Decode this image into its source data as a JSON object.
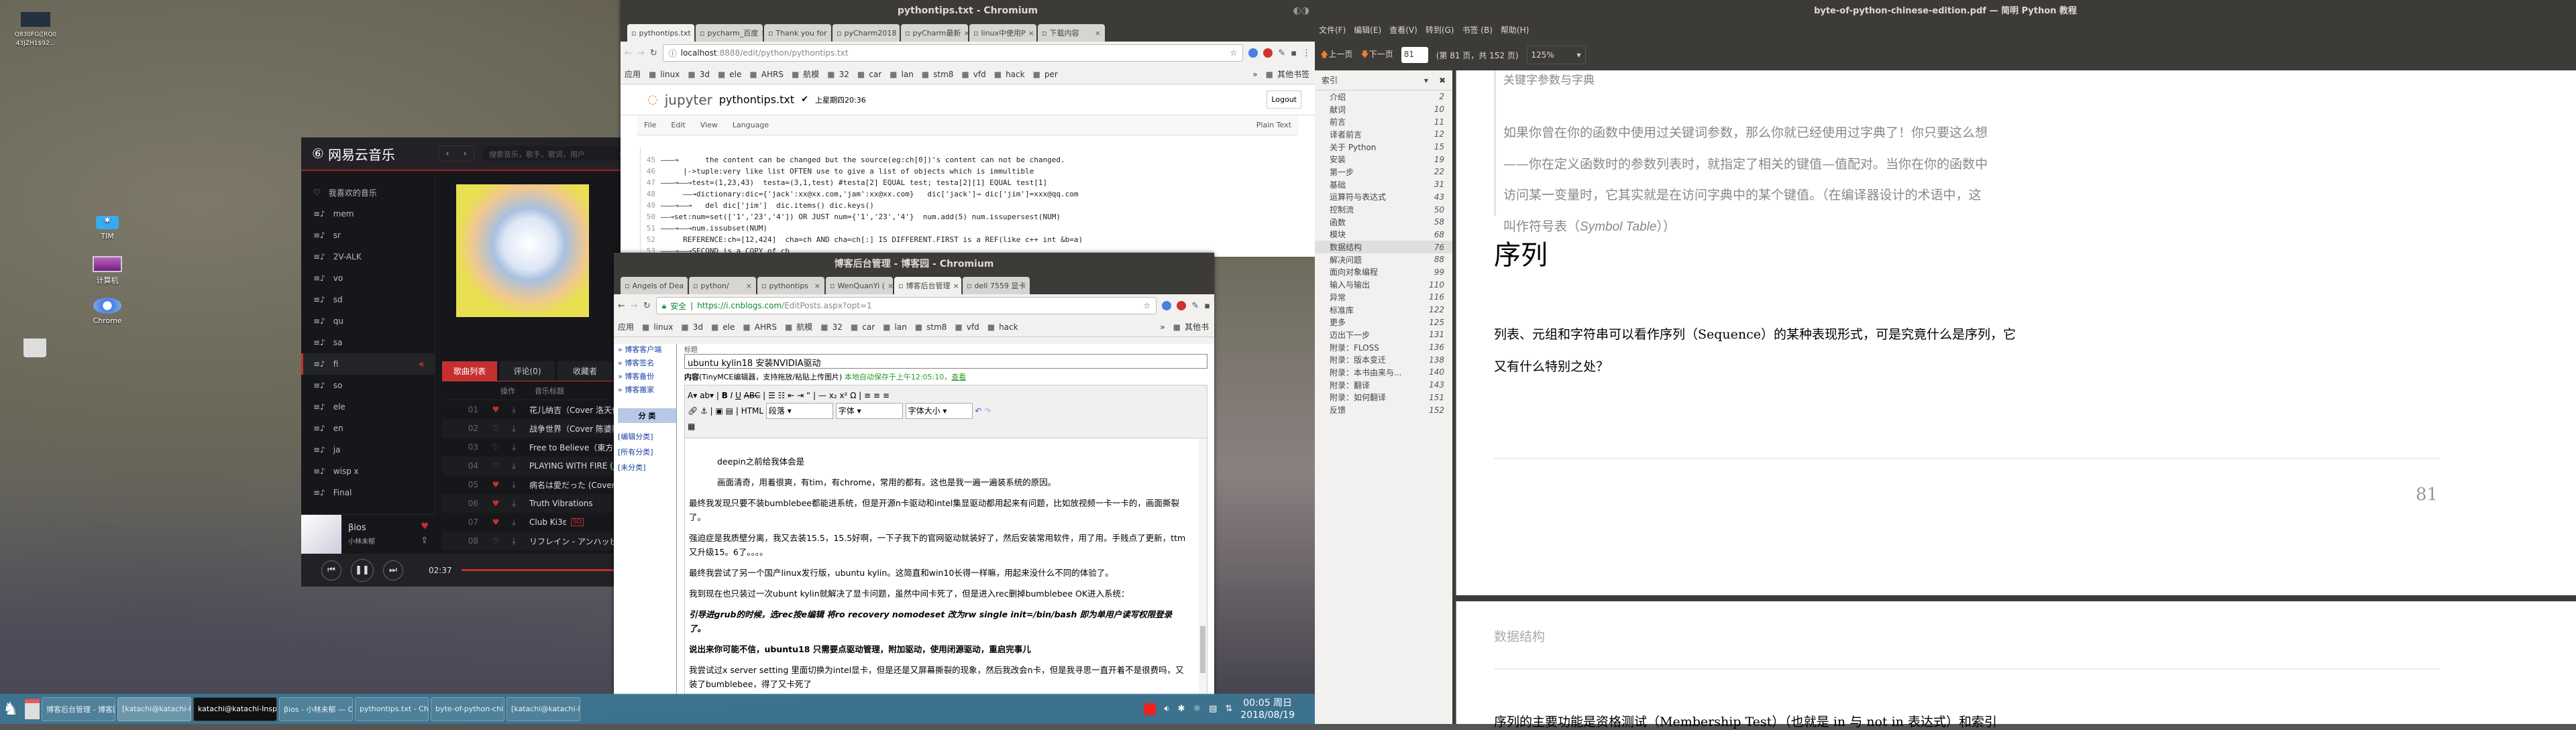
{
  "desktop": {
    "icons": [
      {
        "label": "Q830FG([RQ0 43JZH1$92..."
      },
      {
        "label": "TIM"
      },
      {
        "label": "计算机"
      },
      {
        "label": "Chrome"
      }
    ]
  },
  "music": {
    "app_name": "网易云音乐",
    "search_placeholder": "搜索音乐，歌手，歌词，用户",
    "playlists": [
      {
        "label": "我喜欢的音乐",
        "icon": "heart-icon"
      },
      {
        "label": "mem"
      },
      {
        "label": "sr"
      },
      {
        "label": "2V-ALK"
      },
      {
        "label": "vo"
      },
      {
        "label": "sd"
      },
      {
        "label": "qu"
      },
      {
        "label": "sa"
      },
      {
        "label": "fi",
        "selected": true
      },
      {
        "label": "so"
      },
      {
        "label": "ele"
      },
      {
        "label": "en"
      },
      {
        "label": "ja"
      },
      {
        "label": "wisp x"
      },
      {
        "label": "Final"
      }
    ],
    "tabs": [
      {
        "label": "歌曲列表",
        "active": true
      },
      {
        "label": "评论(0)"
      },
      {
        "label": "收藏者"
      }
    ],
    "columns": [
      "操作",
      "音乐标题"
    ],
    "tracks": [
      {
        "no": "01",
        "liked": true,
        "title": "花儿纳吉（Cover 洛天依&言"
      },
      {
        "no": "02",
        "liked": false,
        "title": "战争世界（Cover 陈婆影）"
      },
      {
        "no": "03",
        "liked": false,
        "title": "Free to Believe（東方星蓮船"
      },
      {
        "no": "04",
        "liked": false,
        "title": "PLAYING WITH FIRE (Japan"
      },
      {
        "no": "05",
        "liked": true,
        "title": "病名は愛だった (Cover 镜音"
      },
      {
        "no": "06",
        "liked": true,
        "title": "Truth Vibrations"
      },
      {
        "no": "07",
        "liked": true,
        "title": "Club Ki3ε",
        "badge": "SQ"
      },
      {
        "no": "08",
        "liked": false,
        "title": "リフレイン - アンハッピ - 双"
      }
    ],
    "now_playing": {
      "title": "βios",
      "artist": "小林未郁",
      "time": "02:37"
    },
    "accent": "#c62f2f"
  },
  "jupyter_window": {
    "title": "pythontips.txt - Chromium",
    "tabs": [
      "pythontips.txt",
      "pycharm_百度",
      "Thank you for",
      "pyCharm2018",
      "pyCharm最新",
      "linux中使用P",
      "下载内容"
    ],
    "url_host": "localhost",
    "url_rest": ":8888/edit/python/pythontips.txt",
    "bookmarks": [
      "应用",
      "linux",
      "3d",
      "ele",
      "AHRS",
      "航模",
      "32",
      "car",
      "lan",
      "stm8",
      "vfd",
      "hack",
      "per"
    ],
    "bookmarks_more": "»",
    "bookmarks_other": "其他书签",
    "jupyter": {
      "logo": "jupyter",
      "filename": "pythontips.txt",
      "saved": "上星期四20:36",
      "logout": "Logout",
      "menu": [
        "File",
        "Edit",
        "View",
        "Language"
      ],
      "mode": "Plain Text"
    },
    "lines": [
      {
        "n": "45",
        "text": "———→      the content can be changed but the source(eg:ch[0])'s content can not be changed."
      },
      {
        "n": "46",
        "text": "     |->tuple:very like list OFTEN use to give a list of objects which is immultible"
      },
      {
        "n": "47",
        "text": "———→——→test=(1,23,43)  testa=(3,1,test) #testa[2] EQUAL test; testa[2][1] EQUAL test[1]"
      },
      {
        "n": "48",
        "text": "     ——→dictionary:dic={'jack':xx@xx.com,'jam':xx@xx.com}   dic['jack']→ dic['jim']=xxx@qq.com"
      },
      {
        "n": "49",
        "text": "———→——→   del dic['jim']  dic.items() dic.keys()"
      },
      {
        "n": "50",
        "text": "——→set:num=set(['1','23','4']) OR JUST num={'1','23','4'}  num.add(5) num.issupersest(NUM)"
      },
      {
        "n": "51",
        "text": "———→——→num.issubset(NUM)"
      },
      {
        "n": "52",
        "text": "     REFERENCE:ch=[12,424]  cha=ch AND cha=ch[:] IS DIFFERENT.FIRST is a REF(like c++ int &b=a)"
      },
      {
        "n": "53",
        "text": "———→——→SECOND is a COPY of ch"
      }
    ]
  },
  "blog_window": {
    "title": "博客后台管理 - 博客园 - Chromium",
    "tabs": [
      "Angels of Dea",
      "python/",
      "pythontips",
      "WenQuanYi (",
      "博客后台管理",
      "dell 7559 显卡"
    ],
    "secure": "安全",
    "url_host": "https://i.cnblogs.com",
    "url_rest": "/EditPosts.aspx?opt=1",
    "bookmarks": [
      "应用",
      "linux",
      "3d",
      "ele",
      "AHRS",
      "航模",
      "32",
      "car",
      "lan",
      "stm8",
      "vfd",
      "hack"
    ],
    "bookmarks_more": "»",
    "bookmarks_other": "其他书",
    "sidebar_links": [
      "» 博客客户端",
      "» 博客签名",
      "» 博客备份",
      "» 博客搬家"
    ],
    "category_header": "分 类",
    "category_links": [
      "[编辑分类]",
      "[所有分类]",
      "[未分类]"
    ],
    "title_label": "标题",
    "post_title": "ubuntu kylin18 安装NVIDIA驱动",
    "content_label": "内容",
    "content_hint": "(TinyMCE编辑器，支持拖放/粘贴上传图片)",
    "autosave": "本地自动保存于上午12:05:10，",
    "view_link": "查看",
    "selects": [
      "段落",
      "字体",
      "字体大小"
    ],
    "paragraphs": [
      {
        "text": "deepin之前给我体会是",
        "indent": true
      },
      {
        "text": "画面清奇，用着很爽，有tim，有chrome，常用的都有。这也是我一遍一遍装系统的原因。",
        "indent": true
      },
      {
        "text": "最终我发现只要不装bumblebee都能进系统，但是开源n卡驱动和intel集显驱动都用起来有问题，比如放视频一卡一卡的，画面撕裂了。"
      },
      {
        "text": "强迫症是我质壁分离，我又去装15.5，15.5好啊，一下子我下的官网驱动就装好了，然后安装常用软件，用了用。手贱点了更新，ttm又升级15。6了。。。。"
      },
      {
        "text": "最终我尝试了另一个国产linux发行版，ubuntu kylin。这简直和win10长得一样嘛，用起来没什么不同的体验了。"
      },
      {
        "text": "我到现在也只装过一次ubunt kylin就解决了显卡问题，虽然中间卡死了，但是进入rec删掉bumblebee OK进入系统："
      },
      {
        "text": "引导进grub的时候，选rec按e编辑 将ro recovery nomodeset 改为rw single init=/bin/bash  即为单用户读写权限登录了。",
        "style": "bi"
      },
      {
        "text": "说出来你可能不信，ubuntu18 只需要点驱动管理，附加驱动，使用闭源驱动，重启完事儿",
        "style": "b"
      },
      {
        "text": "我尝试过x server setting 里面切换为intel显卡，但是还是又屏幕撕裂的现象，然后我改会n卡，但是我寻思一直开着不是很费吗，又装了bumblebee，得了又卡死了"
      }
    ]
  },
  "pdf": {
    "title": "byte-of-python-chinese-edition.pdf — 简明 Python 教程",
    "menu": [
      "文件(F)",
      "编辑(E)",
      "查看(V)",
      "转到(G)",
      "书签 (B)",
      "帮助(H)"
    ],
    "prev": "上一页",
    "next": "下一页",
    "page_input": "81",
    "page_info": "(第 81 页，共 152 页)",
    "zoom": "125%",
    "index_title": "索引",
    "index": [
      {
        "t": "介绍",
        "p": "2"
      },
      {
        "t": "献词",
        "p": "10"
      },
      {
        "t": "前言",
        "p": "11"
      },
      {
        "t": "译者前言",
        "p": "12"
      },
      {
        "t": "关于 Python",
        "p": "15"
      },
      {
        "t": "安装",
        "p": "19"
      },
      {
        "t": "第一步",
        "p": "22"
      },
      {
        "t": "基础",
        "p": "31"
      },
      {
        "t": "运算符与表达式",
        "p": "43"
      },
      {
        "t": "控制流",
        "p": "50"
      },
      {
        "t": "函数",
        "p": "58"
      },
      {
        "t": "模块",
        "p": "68"
      },
      {
        "t": "数据结构",
        "p": "76",
        "selected": true
      },
      {
        "t": "解决问题",
        "p": "88"
      },
      {
        "t": "面向对象编程",
        "p": "99"
      },
      {
        "t": "输入与输出",
        "p": "110"
      },
      {
        "t": "异常",
        "p": "116"
      },
      {
        "t": "标准库",
        "p": "122"
      },
      {
        "t": "更多",
        "p": "125"
      },
      {
        "t": "迈出下一步",
        "p": "131"
      },
      {
        "t": "附录：FLOSS",
        "p": "136"
      },
      {
        "t": "附录：版本变迁",
        "p": "138"
      },
      {
        "t": "附录：本书由来与...",
        "p": "140"
      },
      {
        "t": "附录：翻译",
        "p": "143"
      },
      {
        "t": "附录：如何翻译",
        "p": "151"
      },
      {
        "t": "反馈",
        "p": "152"
      }
    ],
    "quote_title": "关键字参数与字典",
    "quote_lines": [
      "如果你曾在你的函数中使用过关键词参数，那么你就已经使用过字典了！你只要这么想",
      "——你在定义函数时的参数列表时，就指定了相关的键值—值配对。当你在你的函数中",
      "访问某一变量时，它其实就是在访问字典中的某个键值。（在编译器设计的术语中，这"
    ],
    "quote_last_pre": "叫作符号表（",
    "quote_last_em": "Symbol Table",
    "quote_last_post": "））",
    "heading": "序列",
    "body_lines": [
      "列表、元组和字符串可以看作序列（Sequence）的某种表现形式，可是究竟什么是序列，它",
      "又有什么特别之处？"
    ],
    "page_number": "81",
    "next_header": "数据结构",
    "next_body": "序列的主要功能是资格测试（Membership Test）（也就是 in 与 not in 表达式）和索引"
  },
  "taskbar": {
    "items": [
      "博客后台管理 - 博客园 ...",
      "[katachi@katachi-Inspi...",
      "katachi@katachi-Inspiron-7559: ~",
      "βios - 小林未郁 — Clo...",
      "pythontips.txt - Chrom...",
      "byte-of-python-chines...",
      "[katachi@katachi-Inspi..."
    ],
    "time": "00:05 周日",
    "date": "2018/08/19"
  }
}
